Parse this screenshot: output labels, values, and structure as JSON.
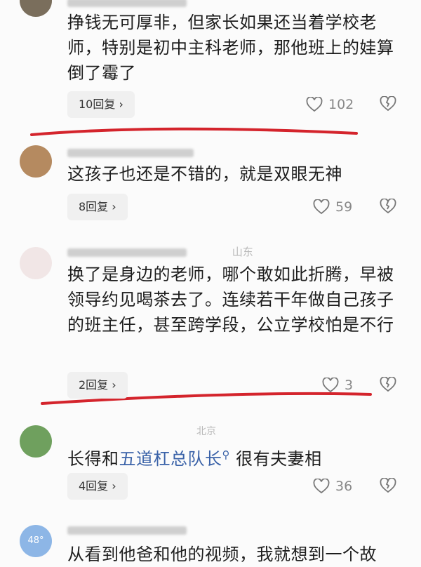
{
  "comments": [
    {
      "text": "挣钱无可厚非，但家长如果还当着学校老师，特别是初中主科老师，那他班上的娃算倒了霉了",
      "replies": "10回复",
      "likes": "102"
    },
    {
      "text": "这孩子也还是不错的，就是双眼无神",
      "replies": "8回复",
      "likes": "59"
    },
    {
      "meta_location": "山东",
      "text": "换了是身边的老师，哪个敢如此折腾，早被领导约见喝茶去了。连续若干年做自己孩子的班主任，甚至跨学段，公立学校怕是不行",
      "replies": "2回复",
      "likes": "3"
    },
    {
      "meta_location": "北京",
      "text_before": "长得和",
      "link": "五道杠总队长",
      "text_after": "很有夫妻相",
      "replies": "4回复",
      "likes": "36"
    },
    {
      "avatar_weather": "48°",
      "text": "从看到他爸和他的视频，我就想到一个故"
    }
  ],
  "colors": {
    "underline": "#d4242c",
    "link": "#3a62a8"
  }
}
